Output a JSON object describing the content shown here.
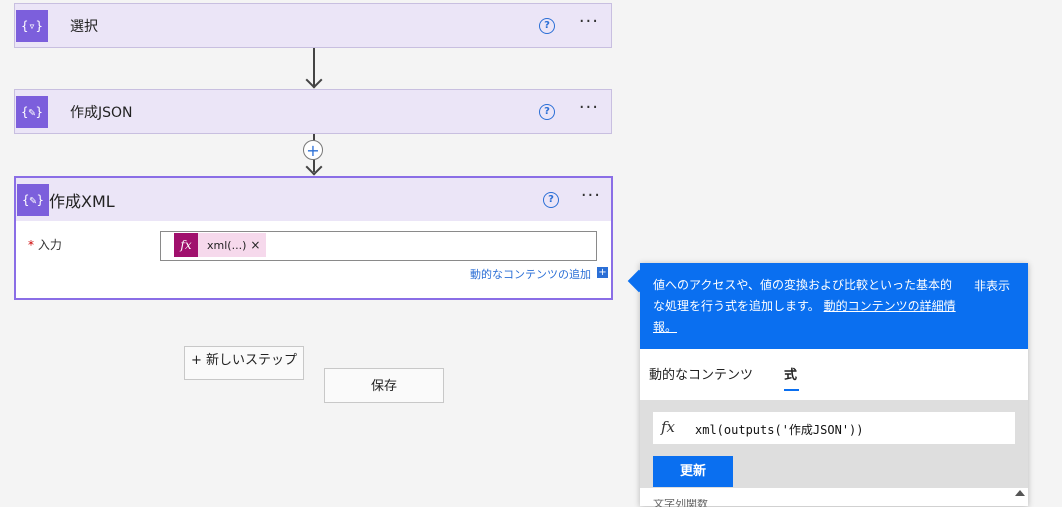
{
  "actions": [
    {
      "title": "選択",
      "icon": "filter-braces-icon"
    },
    {
      "title": "作成JSON",
      "icon": "compose-braces-icon"
    },
    {
      "title": "作成XML",
      "icon": "compose-braces-icon"
    }
  ],
  "compose_xml": {
    "input_label": "入力",
    "required_mark": "*",
    "token_text": "xml(...)",
    "token_remove": "×",
    "dynamic_content_link": "動的なコンテンツの追加",
    "dynamic_add": "+"
  },
  "footer_buttons": {
    "new_step": "+ 新しいステップ",
    "save": "保存"
  },
  "popup": {
    "info_message": "値へのアクセスや、値の変換および比較といった基本的な処理を行う式を追加します。",
    "info_link": "動的コンテンツの詳細情報。",
    "hide": "非表示",
    "tabs": [
      "動的なコンテンツ",
      "式"
    ],
    "active_tab": "式",
    "expression": "xml(outputs('作成JSON'))",
    "update_button": "更新",
    "cut_row_text": "文字列関数"
  },
  "glyphs": {
    "help": "?",
    "more": "···",
    "plus": "+",
    "fx": "fx"
  },
  "colors": {
    "action_header": "#ebe5f7",
    "action_icon": "#7c5fdc",
    "accent_blue": "#0a6ff0",
    "token_fx": "#a0106d"
  }
}
